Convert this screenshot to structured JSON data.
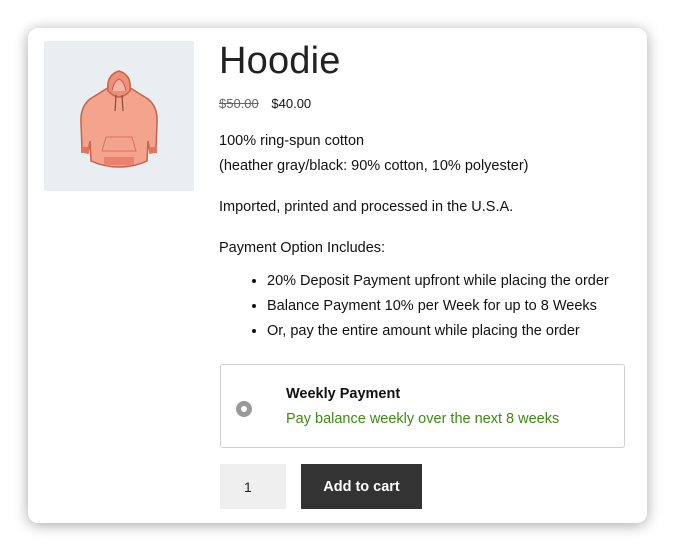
{
  "product": {
    "title": "Hoodie",
    "price_old": "$50.00",
    "price_new": "$40.00",
    "image_icon": "hoodie-icon"
  },
  "description": {
    "line1": "100% ring-spun cotton",
    "line2": "(heather gray/black: 90% cotton, 10% polyester)",
    "line3": "Imported, printed and processed in the U.S.A.",
    "payment_heading": "Payment Option Includes:",
    "payment_options": [
      "20% Deposit Payment upfront while placing the order",
      "Balance Payment 10% per Week for up to 8 Weeks",
      "Or, pay the entire amount while placing the order"
    ]
  },
  "weekly_payment": {
    "title": "Weekly Payment",
    "subtitle": "Pay balance weekly over the next 8 weeks",
    "subtitle_color": "#3b8c0f"
  },
  "cart": {
    "quantity": "1",
    "add_label": "Add to cart"
  }
}
